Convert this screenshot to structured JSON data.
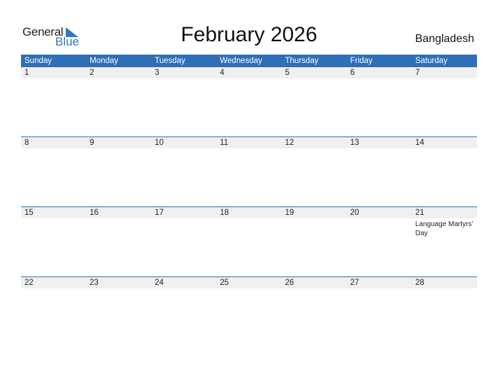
{
  "logo": {
    "general": "General",
    "blue": "Blue"
  },
  "header": {
    "title": "February 2026",
    "country": "Bangladesh"
  },
  "colors": {
    "accent": "#2e6fb5",
    "row_bg": "#f0f0f0"
  },
  "weekdays": [
    "Sunday",
    "Monday",
    "Tuesday",
    "Wednesday",
    "Thursday",
    "Friday",
    "Saturday"
  ],
  "weeks": [
    {
      "days": [
        "1",
        "2",
        "3",
        "4",
        "5",
        "6",
        "7"
      ],
      "holidays": [
        "",
        "",
        "",
        "",
        "",
        "",
        ""
      ]
    },
    {
      "days": [
        "8",
        "9",
        "10",
        "11",
        "12",
        "13",
        "14"
      ],
      "holidays": [
        "",
        "",
        "",
        "",
        "",
        "",
        ""
      ]
    },
    {
      "days": [
        "15",
        "16",
        "17",
        "18",
        "19",
        "20",
        "21"
      ],
      "holidays": [
        "",
        "",
        "",
        "",
        "",
        "",
        "Language Martyrs' Day"
      ]
    },
    {
      "days": [
        "22",
        "23",
        "24",
        "25",
        "26",
        "27",
        "28"
      ],
      "holidays": [
        "",
        "",
        "",
        "",
        "",
        "",
        ""
      ]
    }
  ]
}
